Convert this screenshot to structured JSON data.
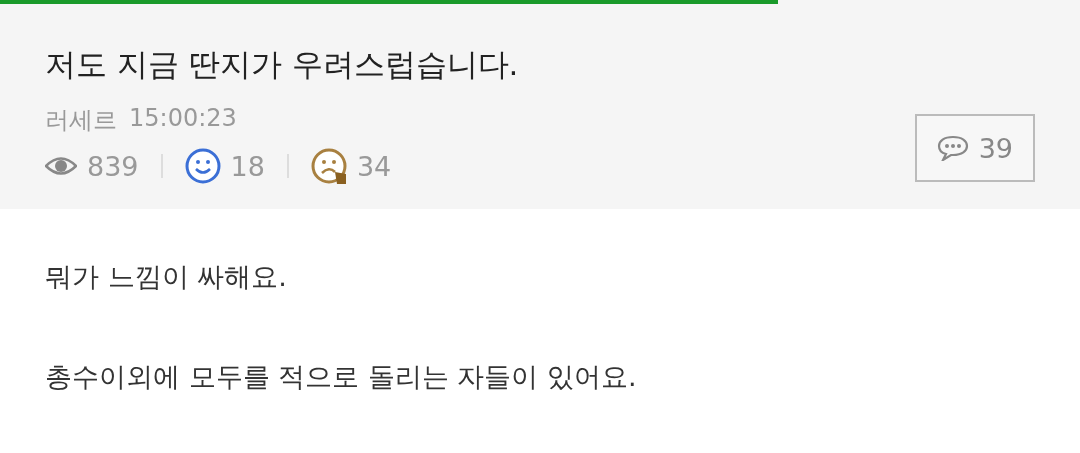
{
  "progress": {
    "level": 0.72
  },
  "post": {
    "title": "저도 지금 딴지가 우려스럽습니다.",
    "author": "러세르",
    "time": "15:00:23",
    "stats": [
      {
        "kind": "views",
        "value": "839"
      },
      {
        "kind": "likes",
        "value": "18"
      },
      {
        "kind": "dislikes",
        "value": "34"
      }
    ],
    "comments": "39"
  },
  "body": [
    "뭐가 느낌이 싸해요.",
    "총수이외에 모두를 적으로 돌리는 자들이 있어요."
  ]
}
